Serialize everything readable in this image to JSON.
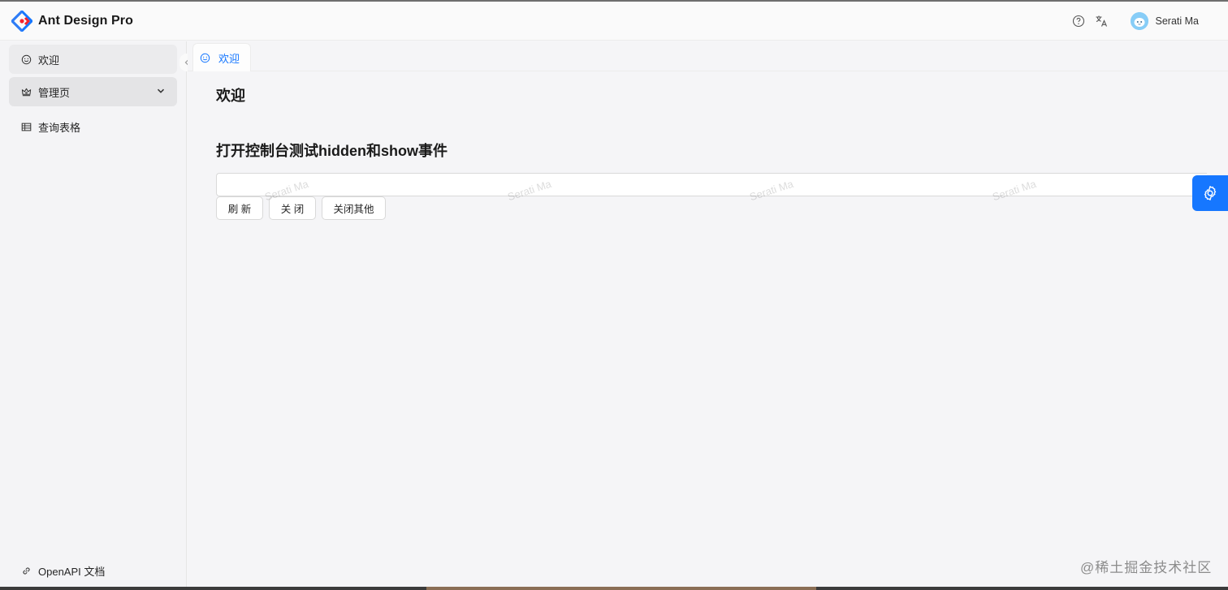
{
  "app": {
    "title": "Ant Design Pro"
  },
  "header": {
    "user_name": "Serati Ma"
  },
  "sidebar": {
    "items": [
      {
        "label": "欢迎",
        "icon": "smile-icon"
      },
      {
        "label": "管理页",
        "icon": "crown-icon"
      },
      {
        "label": "查询表格",
        "icon": "table-icon"
      }
    ],
    "footer": {
      "label": "OpenAPI 文档",
      "icon": "link-icon"
    }
  },
  "tabs": [
    {
      "label": "欢迎",
      "icon": "smile-icon",
      "active": true
    }
  ],
  "main": {
    "title": "欢迎",
    "section_title": "打开控制台测试hidden和show事件",
    "input": {
      "value": "",
      "placeholder": ""
    },
    "buttons": {
      "refresh": "刷 新",
      "close": "关 闭",
      "close_others": "关闭其他"
    },
    "watermark": "Serati Ma"
  },
  "corner": {
    "text": "@稀土掘金技术社区"
  },
  "colors": {
    "accent": "#1677ff"
  }
}
